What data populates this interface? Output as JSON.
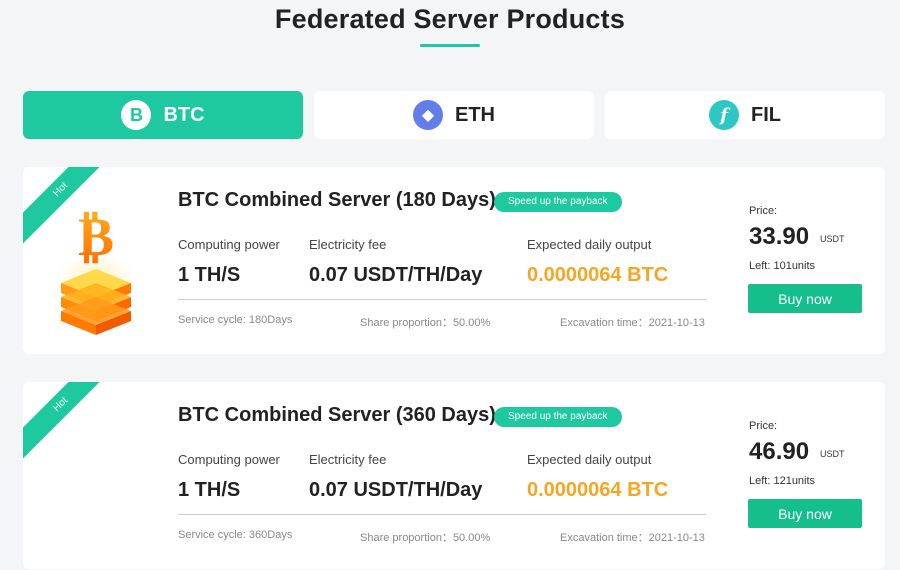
{
  "page_title": "Federated Server Products",
  "tabs": [
    {
      "label": "BTC",
      "icon": "bitcoin-icon",
      "glyph": "B",
      "active": true
    },
    {
      "label": "ETH",
      "icon": "ethereum-icon",
      "glyph": "◆",
      "active": false
    },
    {
      "label": "FIL",
      "icon": "filecoin-icon",
      "glyph": "f",
      "active": false
    }
  ],
  "colors": {
    "accent": "#1ec9a0",
    "orange": "#f5a623",
    "buy": "#14bf8c"
  },
  "labels": {
    "computing_power": "Computing power",
    "electricity_fee": "Electricity fee",
    "expected_output": "Expected daily output",
    "price": "Price:",
    "buy": "Buy now"
  },
  "products": [
    {
      "ribbon": "Hot",
      "title": "BTC Combined Server (180 Days)",
      "badge": "Speed up the payback",
      "computing_power": "1 TH/S",
      "electricity_fee": "0.07 USDT/TH/Day",
      "daily_output": "0.0000064 BTC",
      "service_cycle": "Service cycle:  180Days",
      "share_proportion": "Share proportion：50.00%",
      "excavation_time": "Excavation time：2021-10-13",
      "price": "33.90",
      "currency": "USDT",
      "left": "Left:  101units",
      "has_image": true
    },
    {
      "ribbon": "Hot",
      "title": "BTC Combined Server (360 Days)",
      "badge": "Speed up the payback",
      "computing_power": "1 TH/S",
      "electricity_fee": "0.07 USDT/TH/Day",
      "daily_output": "0.0000064 BTC",
      "service_cycle": "Service cycle:  360Days",
      "share_proportion": "Share proportion：50.00%",
      "excavation_time": "Excavation time：2021-10-13",
      "price": "46.90",
      "currency": "USDT",
      "left": "Left:  121units",
      "has_image": false
    }
  ]
}
